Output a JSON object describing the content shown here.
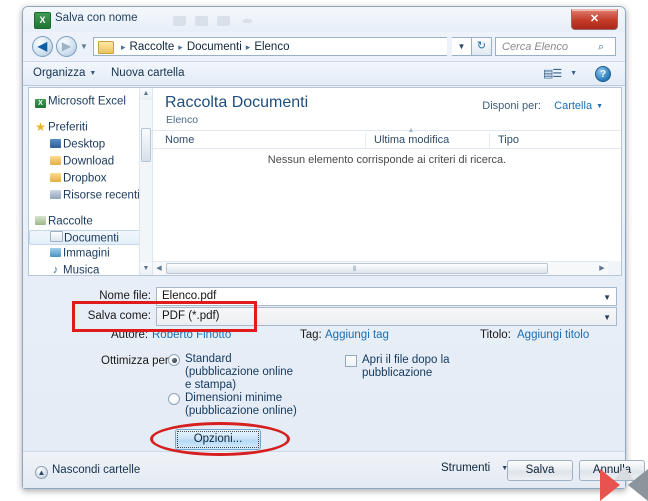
{
  "window": {
    "title": "Salva con nome",
    "app_icon": "excel-icon",
    "close_label": "✕"
  },
  "addressbar": {
    "back_icon": "◀",
    "forward_icon": "▶",
    "history_caret": "▼",
    "breadcrumb": [
      "Raccolte",
      "Documenti",
      "Elenco"
    ],
    "breadcrumb_separator": "▸",
    "path_caret": "▼",
    "refresh_icon": "↻",
    "search_placeholder": "Cerca Elenco",
    "search_icon": "⌕"
  },
  "toolbar": {
    "organize_label": "Organizza",
    "organize_caret": "▼",
    "new_folder_label": "Nuova cartella",
    "view_icon": "▤☰",
    "view_caret": "▼",
    "help_label": "?"
  },
  "navpane": {
    "items": [
      {
        "label": "Microsoft Excel",
        "icon": "excel-icon",
        "level": 1,
        "selected": false
      },
      {
        "label": "Preferiti",
        "icon": "star-icon",
        "level": 1,
        "selected": false
      },
      {
        "label": "Desktop",
        "icon": "desktop-icon",
        "level": 2,
        "selected": false
      },
      {
        "label": "Download",
        "icon": "download-folder-icon",
        "level": 2,
        "selected": false
      },
      {
        "label": "Dropbox",
        "icon": "folder-icon",
        "level": 2,
        "selected": false
      },
      {
        "label": "Risorse recenti",
        "icon": "recent-places-icon",
        "level": 2,
        "selected": false
      },
      {
        "label": "Raccolte",
        "icon": "libraries-icon",
        "level": 1,
        "selected": false
      },
      {
        "label": "Documenti",
        "icon": "documents-icon",
        "level": 2,
        "selected": true
      },
      {
        "label": "Immagini",
        "icon": "pictures-icon",
        "level": 2,
        "selected": false
      },
      {
        "label": "Musica",
        "icon": "music-icon",
        "level": 2,
        "selected": false
      }
    ],
    "scroll_up": "▲",
    "scroll_down": "▼"
  },
  "filepane": {
    "library_title": "Raccolta Documenti",
    "library_subtitle": "Elenco",
    "arrange_label": "Disponi per:",
    "arrange_value": "Cartella",
    "arrange_caret": "▼",
    "columns": [
      "Nome",
      "Ultima modifica",
      "Tipo"
    ],
    "sort_indicator": "▴",
    "empty_message": "Nessun elemento corrisponde ai criteri di ricerca.",
    "hscroll_left": "◀",
    "hscroll_right": "▶",
    "hscroll_grip": "⦀"
  },
  "form": {
    "filename_label": "Nome file:",
    "filename_value": "Elenco.pdf",
    "filetype_label": "Salva come:",
    "filetype_value": "PDF (*.pdf)",
    "combo_caret": "▼",
    "author_label": "Autore:",
    "author_value": "Roberto Finotto",
    "tag_label": "Tag:",
    "tag_value": "Aggiungi tag",
    "title_label": "Titolo:",
    "title_value": "Aggiungi titolo",
    "optimize_label": "Ottimizza per:",
    "optimize_options": [
      {
        "label_line1": "Standard",
        "label_line2": "(pubblicazione online",
        "label_line3": "e stampa)",
        "selected": true
      },
      {
        "label_line1": "Dimensioni minime",
        "label_line2": "(pubblicazione online)",
        "label_line3": "",
        "selected": false
      }
    ],
    "open_after_line1": "Apri il file dopo la",
    "open_after_line2": "pubblicazione",
    "open_after_checked": false
  },
  "buttons": {
    "options_label": "Opzioni...",
    "hide_folders_label": "Nascondi cartelle",
    "hide_folders_icon": "▲",
    "tools_label": "Strumenti",
    "tools_caret": "▼",
    "save_label": "Salva",
    "cancel_label": "Annulla"
  },
  "annotations": {
    "highlight_rectangle": "red-rectangle-around-salva-come",
    "highlight_ellipse": "red-ellipse-around-opzioni-button"
  },
  "watermark": {
    "name": "k-logo-watermark"
  },
  "colors": {
    "annotation_red": "#e01b1b",
    "link_blue": "#1a6fb5",
    "title_blue": "#1d4f7d",
    "close_red": "#c43a28"
  }
}
